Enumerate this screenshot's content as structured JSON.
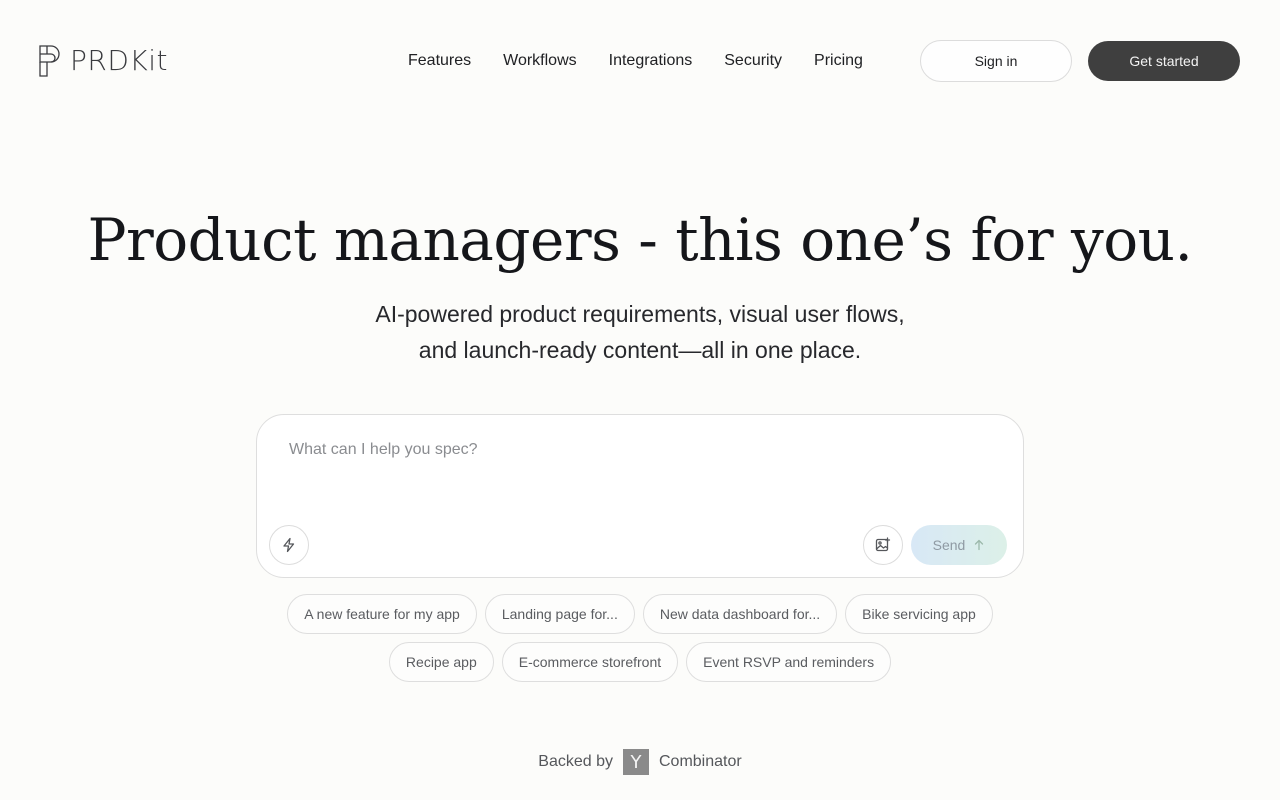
{
  "brand": {
    "name": "PRDKit",
    "logo_icon": "prdkit-logo-icon"
  },
  "nav": {
    "items": [
      "Features",
      "Workflows",
      "Integrations",
      "Security",
      "Pricing"
    ]
  },
  "header": {
    "sign_in_label": "Sign in",
    "get_started_label": "Get started"
  },
  "hero": {
    "title": "Product managers - this one’s for you.",
    "subtitle_line1": "AI-powered product requirements, visual user flows,",
    "subtitle_line2": "and launch-ready content—all in one place."
  },
  "prompt": {
    "placeholder": "What can I help you spec?",
    "value": "",
    "send_label": "Send",
    "bolt_icon": "bolt-icon",
    "image_icon": "image-upload-icon",
    "send_icon": "arrow-up-icon"
  },
  "suggestions": {
    "row1": [
      "A new feature for my app",
      "Landing page for...",
      "New data dashboard for...",
      "Bike servicing app"
    ],
    "row2": [
      "Recipe app",
      "E-commerce storefront",
      "Event RSVP and reminders"
    ]
  },
  "backed": {
    "prefix": "Backed by",
    "logo_letter": "Y",
    "suffix": "Combinator"
  },
  "colors": {
    "background": "#fcfcfa",
    "primary_button": "#3f3f3f",
    "send_gradient_start": "#d8e8f6",
    "send_gradient_end": "#dcf0e8",
    "yc_logo": "#8a8a8a"
  }
}
